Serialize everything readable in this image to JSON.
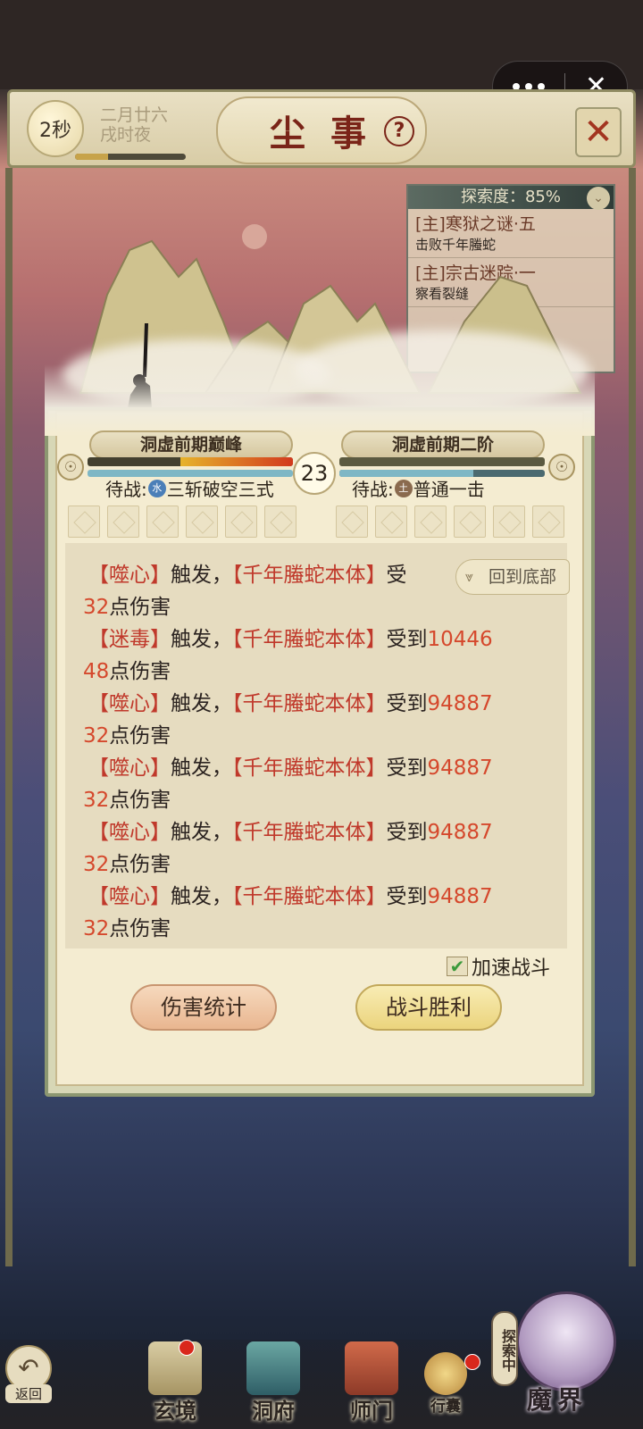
{
  "capsule": {
    "more_icon": "ellipsis-icon",
    "close_icon": "close-icon"
  },
  "header": {
    "timer": "2秒",
    "date": "二月廿六",
    "hour": "戌时夜",
    "time_progress": 0.3,
    "title": "尘事",
    "help_icon": "?",
    "expand_icon": "✕"
  },
  "quest_panel": {
    "explore_label": "探索度：85%",
    "quests": [
      {
        "title": "[主]寒狱之谜·五",
        "desc": "击败千年螣蛇"
      },
      {
        "title": "[主]宗古迷踪·一",
        "desc": "察看裂缝"
      }
    ]
  },
  "battle": {
    "player": {
      "realm": "洞虚前期巅峰",
      "waiting": "待战:",
      "element": "水",
      "skill": "三斩破空三式",
      "hp": 0.55,
      "mp": 1.0
    },
    "enemy": {
      "realm": "洞虚前期二阶",
      "waiting": "待战:",
      "element": "土",
      "skill": "普通一击",
      "hp": 1.0,
      "mp": 0.65
    },
    "round": "23",
    "back_to_bottom": "回到底部",
    "log": [
      {
        "a": "【噬心】",
        "b": "触发，",
        "c": "【千年螣蛇本体】",
        "d": "受",
        "e": "",
        "cont": "32",
        "tail": "点伤害"
      },
      {
        "a": "【迷毒】",
        "b": "触发，",
        "c": "【千年螣蛇本体】",
        "d": "受到",
        "e": "10446",
        "cont": "48",
        "tail": "点伤害"
      },
      {
        "a": "【噬心】",
        "b": "触发，",
        "c": "【千年螣蛇本体】",
        "d": "受到",
        "e": "94887",
        "cont": "32",
        "tail": "点伤害"
      },
      {
        "a": "【噬心】",
        "b": "触发，",
        "c": "【千年螣蛇本体】",
        "d": "受到",
        "e": "94887",
        "cont": "32",
        "tail": "点伤害"
      },
      {
        "a": "【噬心】",
        "b": "触发，",
        "c": "【千年螣蛇本体】",
        "d": "受到",
        "e": "94887",
        "cont": "32",
        "tail": "点伤害"
      },
      {
        "a": "【噬心】",
        "b": "触发，",
        "c": "【千年螣蛇本体】",
        "d": "受到",
        "e": "94887",
        "cont": "32",
        "tail": "点伤害"
      }
    ],
    "speed_label": "加速战斗",
    "speed_checked": true,
    "stats_button": "伤害统计",
    "victory_button": "战斗胜利"
  },
  "nav": {
    "back": "返回",
    "items": [
      "玄境",
      "洞府",
      "师门",
      "行囊"
    ],
    "explore_tag": "探索中",
    "demon_realm": "魔界"
  },
  "colors": {
    "accent_red": "#c0392b",
    "damage_orange": "#d5482c",
    "frame_green": "#8c9771"
  }
}
